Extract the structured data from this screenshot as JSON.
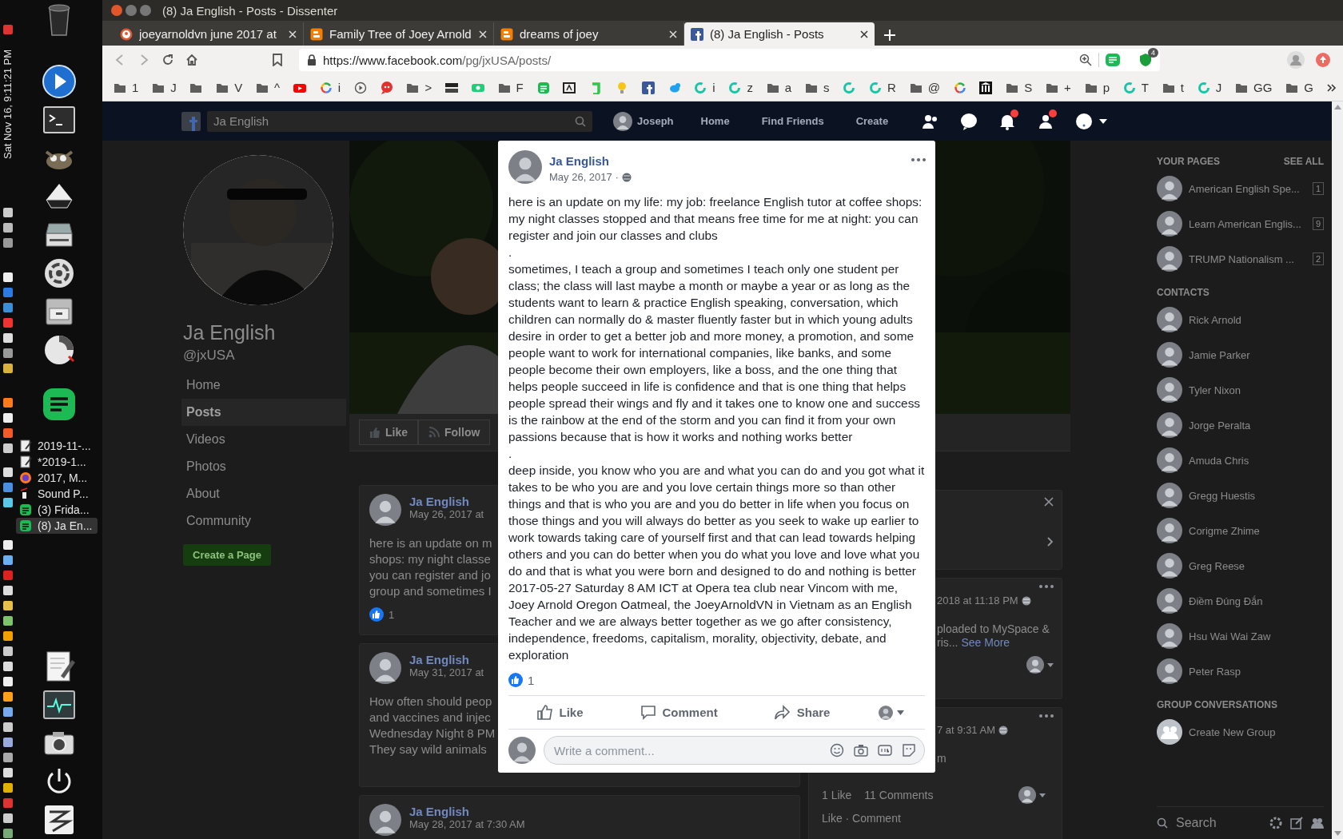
{
  "dock": {
    "clock": "Sat Nov 16, 9:11:21 PM",
    "launchers_top": [
      {
        "kind": "trash"
      },
      {
        "kind": "player"
      },
      {
        "kind": "terminal"
      },
      {
        "kind": "mascot"
      },
      {
        "kind": "pyramid"
      },
      {
        "kind": "scanner"
      },
      {
        "kind": "settings"
      },
      {
        "kind": "drawer"
      },
      {
        "kind": "disc"
      },
      {
        "kind": "notes"
      }
    ],
    "windows": [
      {
        "label": "2019-11-...",
        "kind": "notepad",
        "selected": false
      },
      {
        "label": "*2019-1...",
        "kind": "notepad",
        "selected": false
      },
      {
        "label": "2017, M...",
        "kind": "browser",
        "selected": false
      },
      {
        "label": "Sound P...",
        "kind": "sound",
        "selected": false
      },
      {
        "label": "(3) Frida...",
        "kind": "notes",
        "selected": false
      },
      {
        "label": "(8) Ja En...",
        "kind": "notes",
        "selected": true
      }
    ],
    "launchers_bottom": [
      {
        "kind": "editor"
      },
      {
        "kind": "monitor"
      },
      {
        "kind": "camera"
      },
      {
        "kind": "power"
      },
      {
        "kind": "zigzag"
      }
    ]
  },
  "browser": {
    "title": "(8) Ja English - Posts - Dissenter",
    "tabs": [
      {
        "title": "joeyarnoldvn june 2017 at",
        "kind": "duck",
        "selected": false
      },
      {
        "title": "Family Tree of Joey Arnold",
        "kind": "blog",
        "selected": false
      },
      {
        "title": "dreams of joey",
        "kind": "blog",
        "selected": false
      },
      {
        "title": "(8) Ja English - Posts",
        "kind": "facebook",
        "selected": true
      }
    ],
    "url_host": "https://www.facebook.com",
    "url_path": "/pg/jxUSA/posts/",
    "extension_badge": "4",
    "bookmarks": [
      {
        "kind": "folder",
        "label": "1"
      },
      {
        "kind": "folder",
        "label": "J"
      },
      {
        "kind": "folder"
      },
      {
        "kind": "folder",
        "label": "V"
      },
      {
        "kind": "folder",
        "label": "^"
      },
      {
        "kind": "youtube"
      },
      {
        "kind": "google",
        "label": "i"
      },
      {
        "kind": "play"
      },
      {
        "kind": "quote"
      },
      {
        "kind": "folder",
        "label": ">"
      },
      {
        "kind": "infowars"
      },
      {
        "kind": "gab"
      },
      {
        "kind": "folder",
        "label": "F"
      },
      {
        "kind": "doc"
      },
      {
        "kind": "fs"
      },
      {
        "kind": "g"
      },
      {
        "kind": "bulb"
      },
      {
        "kind": "facebook"
      },
      {
        "kind": "twitter"
      },
      {
        "kind": "swirl",
        "label": "i"
      },
      {
        "kind": "swirl",
        "label": "z"
      },
      {
        "kind": "folder",
        "label": "a"
      },
      {
        "kind": "folder",
        "label": "s"
      },
      {
        "kind": "swirl"
      },
      {
        "kind": "swirl",
        "label": "R"
      },
      {
        "kind": "folder",
        "label": "@"
      },
      {
        "kind": "google"
      },
      {
        "kind": "museum"
      },
      {
        "kind": "folder",
        "label": "S"
      },
      {
        "kind": "folder",
        "label": "+"
      },
      {
        "kind": "folder",
        "label": "p"
      },
      {
        "kind": "swirl",
        "label": "T"
      },
      {
        "kind": "folder",
        "label": "t"
      },
      {
        "kind": "swirl",
        "label": "J"
      },
      {
        "kind": "folder",
        "label": "GG"
      },
      {
        "kind": "folder",
        "label": "G"
      }
    ]
  },
  "facebook": {
    "header": {
      "search": "Ja English",
      "user": "Joseph",
      "nav": [
        "Home",
        "Find Friends",
        "Create"
      ]
    },
    "page": {
      "name": "Ja English",
      "handle": "@jxUSA",
      "nav": [
        {
          "label": "Home",
          "selected": false
        },
        {
          "label": "Posts",
          "selected": true
        },
        {
          "label": "Videos",
          "selected": false
        },
        {
          "label": "Photos",
          "selected": false
        },
        {
          "label": "About",
          "selected": false
        },
        {
          "label": "Community",
          "selected": false
        }
      ],
      "create_button": "Create a Page",
      "actions": [
        {
          "kind": "like",
          "label": "Like"
        },
        {
          "kind": "follow",
          "label": "Follow"
        }
      ]
    },
    "feed_left": [
      {
        "author": "Ja English",
        "date": "May 26, 2017 at",
        "lines": [
          "here is an update on m",
          "shops: my night classe",
          "you can register and jo",
          "group and sometimes I"
        ],
        "likes": "1"
      },
      {
        "author": "Ja English",
        "date": "May 31, 2017 at",
        "lines": [
          "How often should peop",
          "and vaccines and injec",
          "Wednesday Night 8 PM",
          "They say wild animals"
        ]
      },
      {
        "author": "Ja English",
        "date": "May 28, 2017 at 7:30 AM"
      }
    ],
    "feed_right": [
      {
        "time": "2018 at 11:18 PM",
        "lines": [
          "ploaded to MySpace &"
        ],
        "excerpt": "ris...",
        "see_more": "See More"
      },
      {
        "time": "7 at 9:31 AM",
        "lines": [
          "m"
        ],
        "likes": "1 Like",
        "comments": "11 Comments",
        "actions": "Like · Comment"
      }
    ],
    "sidebar": {
      "pages_title": "YOUR PAGES",
      "see_all": "SEE ALL",
      "pages": [
        {
          "name": "American English Spe...",
          "count": "1"
        },
        {
          "name": "Learn American Englis...",
          "count": "9"
        },
        {
          "name": "TRUMP Nationalism ...",
          "count": "2"
        }
      ],
      "contacts_title": "CONTACTS",
      "contacts": [
        "Rick Arnold",
        "Jamie Parker",
        "Tyler Nixon",
        "Jorge Peralta",
        "Amuda Chris",
        "Gregg Huestis",
        "Corigme Zhime",
        "Greg Reese",
        "Điềm Đúng Đắn",
        "Hsu Wai Wai Zaw",
        "Peter Rasp"
      ],
      "groups_title": "GROUP CONVERSATIONS",
      "create_group": "Create New Group",
      "search_placeholder": "Search"
    }
  },
  "post": {
    "author": "Ja English",
    "date": "May 26, 2017 ·",
    "paragraphs": [
      "here is an update on my life: my job: freelance English tutor at coffee shops: my night classes stopped and that means free time for me at night: you can register and join our classes and clubs",
      ".",
      "sometimes, I teach a group and sometimes I teach only one student per class; the class will last maybe a month or maybe a year or as long as the students want to learn & practice English speaking, conversation, which children can normally do & master fluently faster but in which young adults desire in order to get a better job and more money, a promotion, and some people want to work for international companies, like banks, and some people become their own employers, like a boss, and the one thing that helps people succeed in life is confidence and that is one thing that helps people spread their wings and fly and it takes one to know one and success is the rainbow at the end of the storm and you can find it from your own passions because that is how it works and nothing works better",
      ".",
      "deep inside, you know who you are and what you can do and you got what it takes to be who you are and you love certain things more so than other things and that is who you are and you do better in life when you focus on those things and you will always do better as you seek to wake up earlier to work towards taking care of yourself first and that can lead towards helping others and you can do better when you do what you love and love what you do and that is what you were born and designed to do and nothing is better 2017-05-27 Saturday 8 AM ICT at Opera tea club near Vincom with me, Joey Arnold Oregon Oatmeal, the JoeyArnoldVN in Vietnam as an English Teacher and we are always better together as we go after consistency, independence, freedoms, capitalism, morality, objectivity, debate, and exploration"
    ],
    "reaction_count": "1",
    "actions": [
      {
        "kind": "like",
        "label": "Like"
      },
      {
        "kind": "comment",
        "label": "Comment"
      },
      {
        "kind": "share",
        "label": "Share"
      }
    ],
    "comment_placeholder": "Write a comment..."
  }
}
